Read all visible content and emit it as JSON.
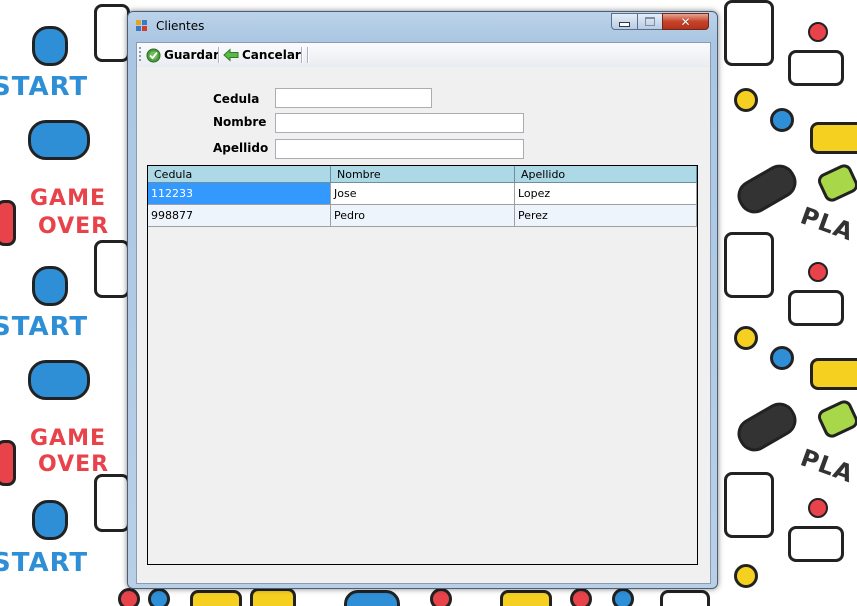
{
  "window": {
    "title": "Clientes"
  },
  "toolbar": {
    "save_label": "Guardar",
    "cancel_label": "Cancelar"
  },
  "form": {
    "cedula_label": "Cedula",
    "nombre_label": "Nombre",
    "apellido_label": "Apellido",
    "cedula_value": "",
    "nombre_value": "",
    "apellido_value": ""
  },
  "grid": {
    "columns": [
      "Cedula",
      "Nombre",
      "Apellido"
    ],
    "rows": [
      [
        "112233",
        "Jose",
        "Lopez"
      ],
      [
        "998877",
        "Pedro",
        "Perez"
      ]
    ],
    "selected_cell": "112233"
  },
  "colors": {
    "header_bg": "#add8e6",
    "selection": "#3399ff",
    "close_button": "#c7432a"
  },
  "wallpaper": {
    "words": [
      "START",
      "GAME",
      "OVER",
      "PLA"
    ]
  }
}
